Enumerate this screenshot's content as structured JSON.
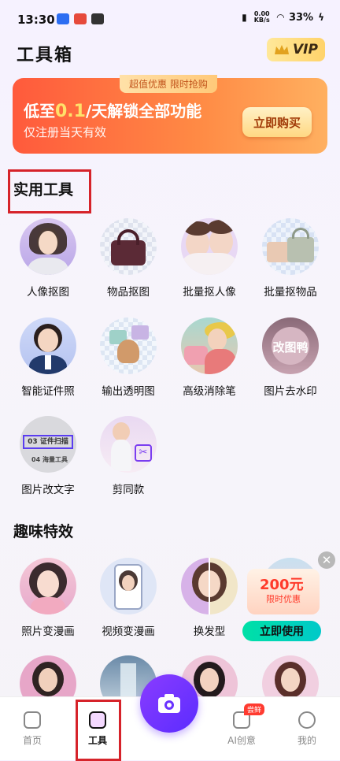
{
  "status_bar": {
    "time": "13:30",
    "net_speed": "0.00 KB/s",
    "battery": "33%"
  },
  "header": {
    "title": "工具箱",
    "vip_label": "VIP"
  },
  "promo": {
    "tab": "超值优惠  限时抢购",
    "title_prefix": "低至",
    "title_highlight": "0.1",
    "title_suffix": "/天解锁全部功能",
    "subtitle": "仅注册当天有效",
    "button": "立即购买"
  },
  "sections": {
    "utility_title": "实用工具",
    "fun_title": "趣味特效"
  },
  "utility_tools": [
    {
      "label": "人像抠图",
      "icon": "portrait-cutout-icon"
    },
    {
      "label": "物品抠图",
      "icon": "object-cutout-icon"
    },
    {
      "label": "批量抠人像",
      "icon": "batch-portrait-icon"
    },
    {
      "label": "批量抠物品",
      "icon": "batch-object-icon"
    },
    {
      "label": "智能证件照",
      "icon": "id-photo-icon"
    },
    {
      "label": "输出透明图",
      "icon": "transparent-export-icon"
    },
    {
      "label": "高级消除笔",
      "icon": "eraser-pen-icon"
    },
    {
      "label": "图片去水印",
      "icon": "watermark-remove-icon"
    },
    {
      "label": "图片改文字",
      "icon": "edit-text-icon"
    },
    {
      "label": "剪同款",
      "icon": "template-cut-icon"
    }
  ],
  "thumb_text": {
    "watermark": "改图鸭",
    "doc_line1": "03 证件扫描",
    "doc_line2": "04 海量工具"
  },
  "fun_tools": [
    {
      "label": "照片变漫画",
      "icon": "photo-to-comic-icon"
    },
    {
      "label": "视频变漫画",
      "icon": "video-to-comic-icon"
    },
    {
      "label": "换发型",
      "icon": "hairstyle-icon"
    }
  ],
  "float_ad": {
    "amount": "200元",
    "sub": "限时优惠",
    "button": "立即使用"
  },
  "bottom_nav": {
    "home": "首页",
    "tools": "工具",
    "ai": "AI创意",
    "ai_badge": "尝鲜",
    "me": "我的"
  },
  "colors": {
    "accent": "#6a33ff",
    "promo": "#ff6a3d",
    "highlight_box": "#d6232a"
  }
}
